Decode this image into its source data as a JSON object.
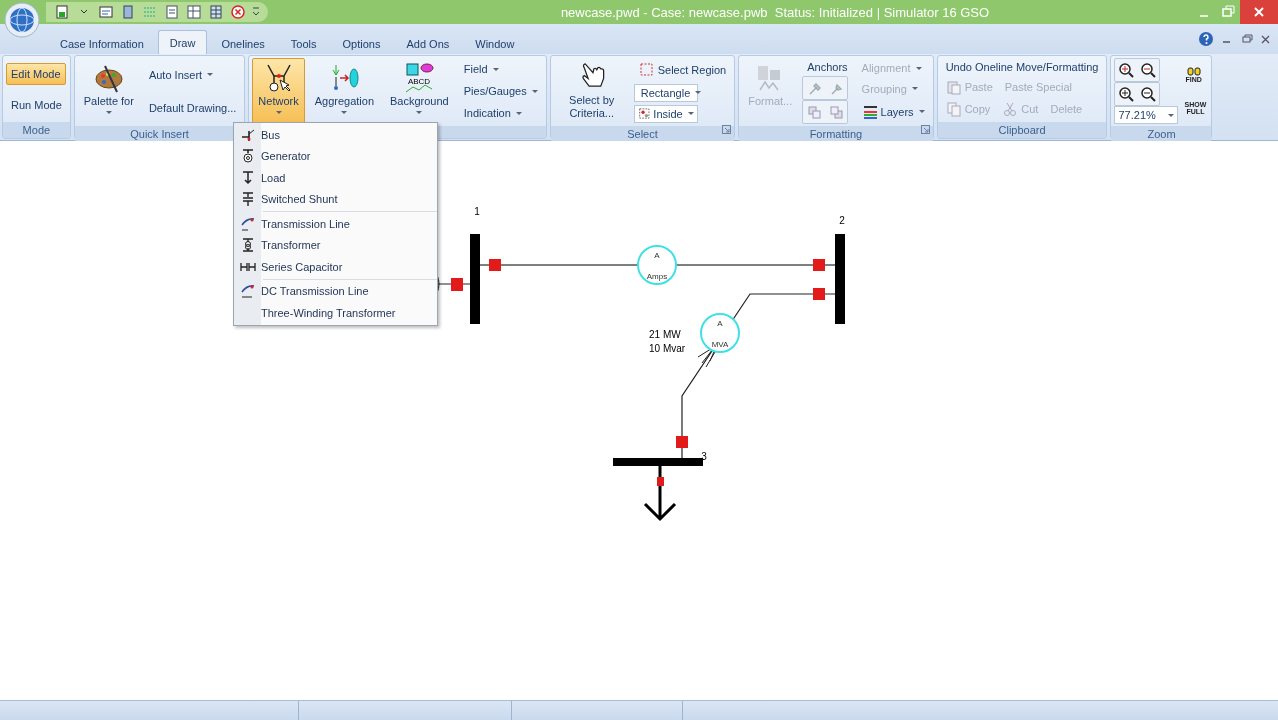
{
  "window": {
    "title": "newcase.pwd - Case: newcase.pwb  Status: Initialized | Simulator 16 GSO"
  },
  "tabs": [
    {
      "label": "Case Information",
      "selected": false
    },
    {
      "label": "Draw",
      "selected": true
    },
    {
      "label": "Onelines",
      "selected": false
    },
    {
      "label": "Tools",
      "selected": false
    },
    {
      "label": "Options",
      "selected": false
    },
    {
      "label": "Add Ons",
      "selected": false
    },
    {
      "label": "Window",
      "selected": false
    }
  ],
  "ribbon": {
    "groups": [
      {
        "label": "Mode",
        "launcher": false,
        "columns": [
          [
            {
              "kind": "toggle",
              "label": "Edit Mode",
              "selected": true
            },
            {
              "kind": "toggle",
              "label": "Run Mode",
              "selected": false
            }
          ]
        ]
      },
      {
        "label": "Quick Insert",
        "launcher": false,
        "columns": [
          [
            {
              "kind": "large",
              "label": "Palette for",
              "dropdown": true,
              "selected": false
            }
          ],
          [
            {
              "kind": "small",
              "label": "Auto Insert",
              "dropdown": true
            },
            {
              "kind": "small",
              "label": "Default Drawing...",
              "dropdown": false
            }
          ]
        ]
      },
      {
        "launcher": false,
        "columns": [
          [
            {
              "kind": "large",
              "label": "Network",
              "dropdown": true,
              "selected": true
            }
          ],
          [
            {
              "kind": "large",
              "label": "Aggregation",
              "dropdown": true,
              "selected": false
            }
          ],
          [
            {
              "kind": "large",
              "label": "Background",
              "dropdown": true,
              "selected": false,
              "icon_caption": "ABCD"
            }
          ],
          [
            {
              "kind": "small",
              "label": "Field",
              "dropdown": true
            },
            {
              "kind": "small",
              "label": "Pies/Gauges",
              "dropdown": true
            },
            {
              "kind": "small",
              "label": "Indication",
              "dropdown": true
            }
          ]
        ]
      },
      {
        "label": "Select",
        "launcher": true,
        "columns": [
          [
            {
              "kind": "large",
              "label": "Select by Criteria...",
              "dropdown": false,
              "selected": false
            }
          ],
          [
            {
              "kind": "small",
              "label": "Select Region",
              "dropdown": false
            },
            {
              "kind": "combo",
              "value": "Rectangle"
            },
            {
              "kind": "combo",
              "value": "Inside"
            }
          ]
        ]
      },
      {
        "label": "Formatting",
        "launcher": true,
        "columns": [
          [
            {
              "kind": "large",
              "label": "Format...",
              "dropdown": false,
              "selected": false,
              "disabled": true
            }
          ],
          [
            {
              "kind": "small",
              "label": "Anchors",
              "dropdown": false
            },
            {
              "kind": "icon_pair"
            },
            {
              "kind": "icon_pair"
            }
          ],
          [
            {
              "kind": "small",
              "label": "Alignment",
              "dropdown": true,
              "disabled": true
            },
            {
              "kind": "small",
              "label": "Grouping",
              "dropdown": true,
              "disabled": true
            },
            {
              "kind": "small",
              "label": "Layers",
              "dropdown": true,
              "disabled": false
            }
          ]
        ]
      },
      {
        "label": "Clipboard",
        "launcher": false,
        "columns": [
          [
            {
              "kind": "small",
              "label": "Undo Oneline Move/Formatting",
              "dropdown": false,
              "disabled": false
            },
            {
              "kind": "row",
              "items": [
                {
                  "kind": "small",
                  "label": "Paste",
                  "disabled": true
                },
                {
                  "kind": "small",
                  "label": "Paste Special",
                  "disabled": true
                }
              ]
            },
            {
              "kind": "row",
              "items": [
                {
                  "kind": "small",
                  "label": "Copy",
                  "disabled": true
                },
                {
                  "kind": "small",
                  "label": "Cut",
                  "disabled": true
                },
                {
                  "kind": "small",
                  "label": "Delete",
                  "disabled": true
                }
              ]
            }
          ]
        ]
      },
      {
        "label": "Zoom",
        "launcher": false,
        "columns": [
          [
            {
              "kind": "icon_pair"
            },
            {
              "kind": "icon_pair"
            },
            {
              "kind": "combo",
              "value": "77.21%"
            }
          ],
          [
            {
              "kind": "icon_text",
              "label": "FIND"
            },
            {
              "kind": "icon_text",
              "label": "SHOW FULL"
            }
          ]
        ]
      }
    ]
  },
  "oneline": {
    "buses": [
      {
        "label": "1"
      },
      {
        "label": "2"
      },
      {
        "label": "3"
      }
    ],
    "gauges": [
      {
        "top": "A",
        "bottom": "Amps"
      },
      {
        "top": "A",
        "bottom": "MVA"
      }
    ],
    "load_flow": [
      "21 MW",
      "10 Mvar"
    ]
  },
  "network_menu": {
    "sections": [
      [
        {
          "label": "Bus"
        },
        {
          "label": "Generator"
        },
        {
          "label": "Load"
        },
        {
          "label": "Switched Shunt"
        }
      ],
      [
        {
          "label": "Transmission Line"
        },
        {
          "label": "Transformer"
        },
        {
          "label": "Series Capacitor"
        }
      ],
      [
        {
          "label": "DC Transmission Line"
        },
        {
          "label": "Three-Winding Transformer"
        }
      ]
    ]
  }
}
